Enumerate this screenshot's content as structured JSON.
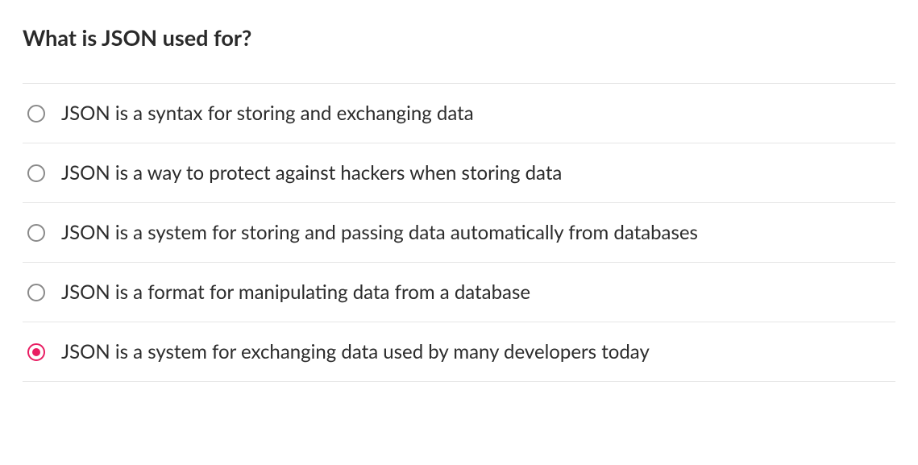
{
  "question": {
    "title": "What is JSON used for?",
    "options": [
      {
        "label": "JSON is a syntax for storing and exchanging data",
        "selected": false
      },
      {
        "label": "JSON is a way to protect against hackers when storing data",
        "selected": false
      },
      {
        "label": "JSON is a system for storing and passing data automatically from databases",
        "selected": false
      },
      {
        "label": "JSON is a format for manipulating data from a database",
        "selected": false
      },
      {
        "label": "JSON is a system for exchanging data used by many developers today",
        "selected": true
      }
    ]
  }
}
